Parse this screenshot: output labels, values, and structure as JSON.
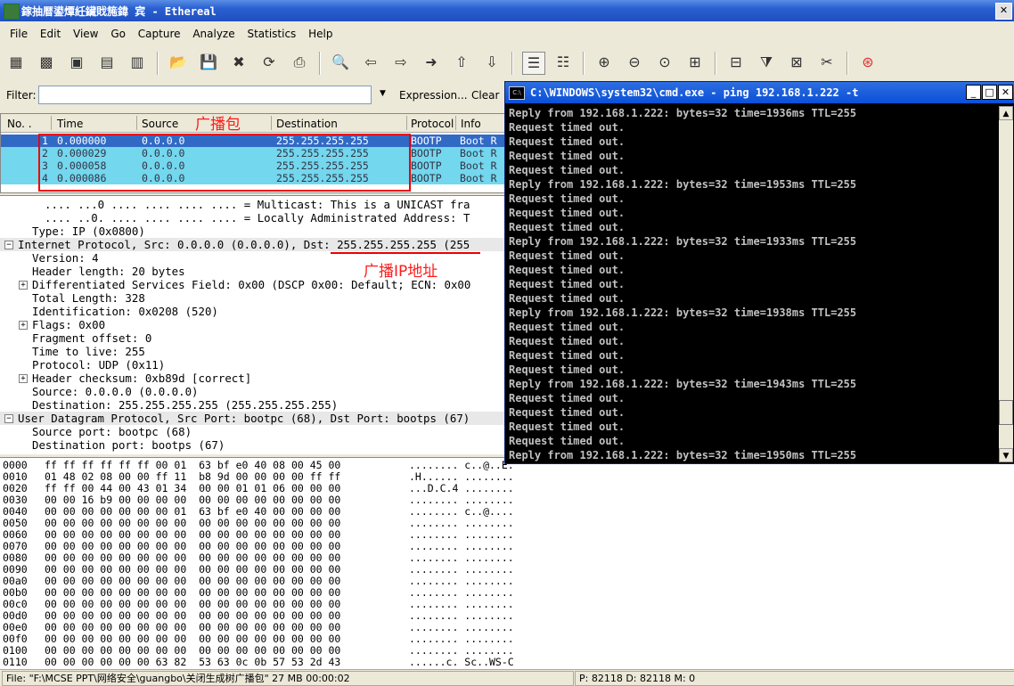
{
  "window": {
    "title": "鎵抽暦鍙燂紝鑶戝箷鍏  宾 - Ethereal"
  },
  "menu": [
    "File",
    "Edit",
    "View",
    "Go",
    "Capture",
    "Analyze",
    "Statistics",
    "Help"
  ],
  "toolbar_icons": [
    "interfaces-icon",
    "capture-options-icon",
    "start-capture-icon",
    "stop-capture-icon",
    "restart-capture-icon",
    "open-icon",
    "save-icon",
    "close-icon",
    "reload-icon",
    "print-icon",
    "find-icon",
    "back-icon",
    "forward-icon",
    "goto-icon",
    "first-icon",
    "last-icon",
    "colorize-icon",
    "autoscroll-icon",
    "zoom-in-icon",
    "zoom-out-icon",
    "zoom-normal-icon",
    "resize-columns-icon",
    "capture-filters-icon",
    "display-filters-icon",
    "coloring-rules-icon",
    "preferences-icon",
    "help-icon"
  ],
  "filter": {
    "label": "Filter:",
    "value": "",
    "expression": "Expression...",
    "clear": "Clear"
  },
  "packet_list": {
    "columns": [
      "No. .",
      "Time",
      "Source",
      "Destination",
      "Protocol",
      "Info"
    ],
    "rows": [
      {
        "no": "1",
        "time": "0.000000",
        "source": "0.0.0.0",
        "dest": "255.255.255.255",
        "proto": "BOOTP",
        "info": "Boot R"
      },
      {
        "no": "2",
        "time": "0.000029",
        "source": "0.0.0.0",
        "dest": "255.255.255.255",
        "proto": "BOOTP",
        "info": "Boot R"
      },
      {
        "no": "3",
        "time": "0.000058",
        "source": "0.0.0.0",
        "dest": "255.255.255.255",
        "proto": "BOOTP",
        "info": "Boot R"
      },
      {
        "no": "4",
        "time": "0.000086",
        "source": "0.0.0.0",
        "dest": "255.255.255.255",
        "proto": "BOOTP",
        "info": "Boot R"
      }
    ]
  },
  "detail": [
    {
      "text": ".... ...0 .... .... .... .... = Multicast: This is a UNICAST fra",
      "indent": 3
    },
    {
      "text": ".... ..0. .... .... .... .... = Locally Administrated Address: T",
      "indent": 3
    },
    {
      "text": "Type: IP (0x0800)",
      "indent": 2
    },
    {
      "text": "Internet Protocol, Src: 0.0.0.0 (0.0.0.0), Dst: 255.255.255.255 (255",
      "indent": 1,
      "expander": "−",
      "hl": true
    },
    {
      "text": "Version: 4",
      "indent": 2
    },
    {
      "text": "Header length: 20 bytes",
      "indent": 2
    },
    {
      "text": "Differentiated Services Field: 0x00 (DSCP 0x00: Default; ECN: 0x00",
      "indent": 2,
      "expander": "+"
    },
    {
      "text": "Total Length: 328",
      "indent": 2
    },
    {
      "text": "Identification: 0x0208 (520)",
      "indent": 2
    },
    {
      "text": "Flags: 0x00",
      "indent": 2,
      "expander": "+"
    },
    {
      "text": "Fragment offset: 0",
      "indent": 2
    },
    {
      "text": "Time to live: 255",
      "indent": 2
    },
    {
      "text": "Protocol: UDP (0x11)",
      "indent": 2
    },
    {
      "text": "Header checksum: 0xb89d [correct]",
      "indent": 2,
      "expander": "+"
    },
    {
      "text": "Source: 0.0.0.0 (0.0.0.0)",
      "indent": 2
    },
    {
      "text": "Destination: 255.255.255.255 (255.255.255.255)",
      "indent": 2
    },
    {
      "text": "User Datagram Protocol, Src Port: bootpc (68), Dst Port: bootps (67)",
      "indent": 1,
      "expander": "−",
      "hl": true
    },
    {
      "text": "Source port: bootpc (68)",
      "indent": 2
    },
    {
      "text": "Destination port: bootps (67)",
      "indent": 2
    }
  ],
  "hex": [
    {
      "off": "0000",
      "bytes": "ff ff ff ff ff ff 00 01  63 bf e0 40 08 00 45 00",
      "ascii": "........ c..@..E."
    },
    {
      "off": "0010",
      "bytes": "01 48 02 08 00 00 ff 11  b8 9d 00 00 00 00 ff ff",
      "ascii": ".H...... ........"
    },
    {
      "off": "0020",
      "bytes": "ff ff 00 44 00 43 01 34  00 00 01 01 06 00 00 00",
      "ascii": "...D.C.4 ........"
    },
    {
      "off": "0030",
      "bytes": "00 00 16 b9 00 00 00 00  00 00 00 00 00 00 00 00",
      "ascii": "........ ........"
    },
    {
      "off": "0040",
      "bytes": "00 00 00 00 00 00 00 01  63 bf e0 40 00 00 00 00",
      "ascii": "........ c..@...."
    },
    {
      "off": "0050",
      "bytes": "00 00 00 00 00 00 00 00  00 00 00 00 00 00 00 00",
      "ascii": "........ ........"
    },
    {
      "off": "0060",
      "bytes": "00 00 00 00 00 00 00 00  00 00 00 00 00 00 00 00",
      "ascii": "........ ........"
    },
    {
      "off": "0070",
      "bytes": "00 00 00 00 00 00 00 00  00 00 00 00 00 00 00 00",
      "ascii": "........ ........"
    },
    {
      "off": "0080",
      "bytes": "00 00 00 00 00 00 00 00  00 00 00 00 00 00 00 00",
      "ascii": "........ ........"
    },
    {
      "off": "0090",
      "bytes": "00 00 00 00 00 00 00 00  00 00 00 00 00 00 00 00",
      "ascii": "........ ........"
    },
    {
      "off": "00a0",
      "bytes": "00 00 00 00 00 00 00 00  00 00 00 00 00 00 00 00",
      "ascii": "........ ........"
    },
    {
      "off": "00b0",
      "bytes": "00 00 00 00 00 00 00 00  00 00 00 00 00 00 00 00",
      "ascii": "........ ........"
    },
    {
      "off": "00c0",
      "bytes": "00 00 00 00 00 00 00 00  00 00 00 00 00 00 00 00",
      "ascii": "........ ........"
    },
    {
      "off": "00d0",
      "bytes": "00 00 00 00 00 00 00 00  00 00 00 00 00 00 00 00",
      "ascii": "........ ........"
    },
    {
      "off": "00e0",
      "bytes": "00 00 00 00 00 00 00 00  00 00 00 00 00 00 00 00",
      "ascii": "........ ........"
    },
    {
      "off": "00f0",
      "bytes": "00 00 00 00 00 00 00 00  00 00 00 00 00 00 00 00",
      "ascii": "........ ........"
    },
    {
      "off": "0100",
      "bytes": "00 00 00 00 00 00 00 00  00 00 00 00 00 00 00 00",
      "ascii": "........ ........"
    },
    {
      "off": "0110",
      "bytes": "00 00 00 00 00 00 63 82  53 63 0c 0b 57 53 2d 43",
      "ascii": "......c. Sc..WS-C"
    }
  ],
  "status": {
    "left": "File: \"F:\\MCSE PPT\\网络安全\\guangbo\\关闭生成树广播包\" 27 MB 00:00:02",
    "right": "P: 82118 D: 82118 M: 0"
  },
  "cmd": {
    "title": "C:\\WINDOWS\\system32\\cmd.exe - ping 192.168.1.222 -t",
    "lines": [
      "Reply from 192.168.1.222: bytes=32 time=1936ms TTL=255",
      "Request timed out.",
      "Request timed out.",
      "Request timed out.",
      "Request timed out.",
      "Reply from 192.168.1.222: bytes=32 time=1953ms TTL=255",
      "Request timed out.",
      "Request timed out.",
      "Request timed out.",
      "Reply from 192.168.1.222: bytes=32 time=1933ms TTL=255",
      "Request timed out.",
      "Request timed out.",
      "Request timed out.",
      "Request timed out.",
      "Reply from 192.168.1.222: bytes=32 time=1938ms TTL=255",
      "Request timed out.",
      "Request timed out.",
      "Request timed out.",
      "Request timed out.",
      "Reply from 192.168.1.222: bytes=32 time=1943ms TTL=255",
      "Request timed out.",
      "Request timed out.",
      "Request timed out.",
      "Request timed out.",
      "Reply from 192.168.1.222: bytes=32 time=1950ms TTL=255"
    ],
    "ime": "搜狗拼音 半:"
  },
  "annotations": {
    "broadcast_packet": "广播包",
    "broadcast_ip": "广播IP地址"
  },
  "colors": {
    "selected_row": "#316ac5",
    "bootp_row": "#73d7ee",
    "annotation": "#ff0000"
  }
}
